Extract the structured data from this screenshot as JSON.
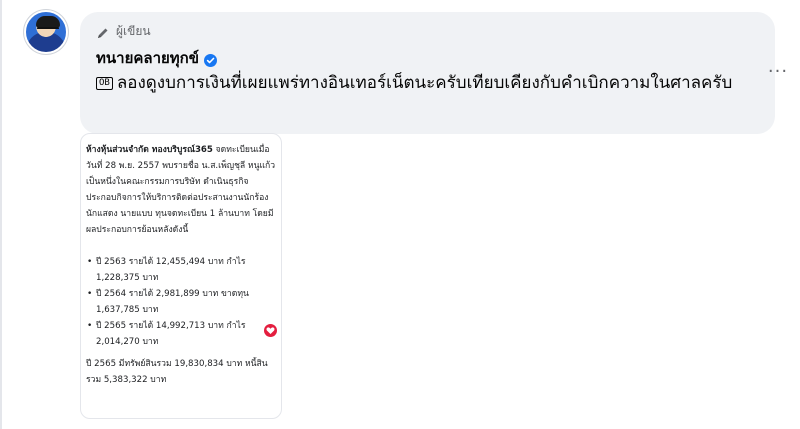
{
  "comment": {
    "author_label": "ผู้เขียน",
    "author_name": "ทนายคลายทุกข์",
    "badge": "OB",
    "text": "ลองดูงบการเงินที่เผยแพร่ทางอินเทอร์เน็ตนะครับเทียบเคียงกับคำเบิกความในศาลครับ",
    "more_label": "···"
  },
  "attachment": {
    "intro_bold": "ห้างหุ้นส่วนจำกัด ทองบริบูรณ์365",
    "intro_text": " จดทะเบียนเมื่อวันที่ 28 พ.ย. 2557 พบรายชื่อ น.ส.เพ็ญชุลี หนูแก้ว เป็นหนึ่งในคณะกรรมการบริษัท ดำเนินธุรกิจประกอบกิจการให้บริการติดต่อประสานงานนักร้องนักแสดง นายแบบ ทุนจดทะเบียน 1 ล้านบาท โดยมีผลประกอบการย้อนหลังดังนี้",
    "items": [
      "ปี 2563 รายได้ 12,455,494 บาท กำไร 1,228,375 บาท",
      "ปี 2564 รายได้ 2,981,899 บาท ขาดทุน 1,637,785 บาท",
      "ปี 2565 รายได้ 14,992,713 บาท กำไร 2,014,270 บาท"
    ],
    "footer": "ปี 2565 มีทรัพย์สินรวม 19,830,834 บาท หนี้สินรวม 5,383,322 บาท"
  },
  "colors": {
    "bubble": "#f0f2f5",
    "verified": "#1877f2",
    "reaction": "#e41e3f"
  },
  "icons": {
    "author": "pencil-icon",
    "verified": "verified-badge-icon",
    "reaction": "heart-icon"
  }
}
